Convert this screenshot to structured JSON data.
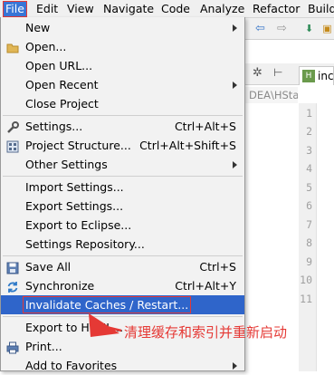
{
  "menubar": {
    "items": [
      "File",
      "Edit",
      "View",
      "Navigate",
      "Code",
      "Analyze",
      "Refactor",
      "Build"
    ]
  },
  "editor": {
    "tab_label": "inc",
    "path_text": "DEA\\HStat",
    "line_numbers": [
      "1",
      "2",
      "3",
      "4",
      "5",
      "6",
      "7",
      "8",
      "9",
      "10",
      "11"
    ],
    "current_line": "10"
  },
  "file_menu": {
    "new": "New",
    "open": "Open...",
    "open_url": "Open URL...",
    "open_recent": "Open Recent",
    "close_project": "Close Project",
    "settings": "Settings...",
    "settings_shortcut": "Ctrl+Alt+S",
    "project_structure": "Project Structure...",
    "project_structure_shortcut": "Ctrl+Alt+Shift+S",
    "other_settings": "Other Settings",
    "import_settings": "Import Settings...",
    "export_settings": "Export Settings...",
    "export_eclipse": "Export to Eclipse...",
    "settings_repository": "Settings Repository...",
    "save_all": "Save All",
    "save_all_shortcut": "Ctrl+S",
    "synchronize": "Synchronize",
    "synchronize_shortcut": "Ctrl+Alt+Y",
    "invalidate_caches": "Invalidate Caches / Restart...",
    "export_html": "Export to HTML...",
    "print": "Print...",
    "add_to_favorites": "Add to Favorites"
  },
  "annotation": {
    "text": "清理缓存和索引并重新启动",
    "color": "#e53935"
  },
  "colors": {
    "selection": "#2f65ca",
    "highlight_border": "#e53935",
    "menu_bg": "#f2f2f2"
  }
}
